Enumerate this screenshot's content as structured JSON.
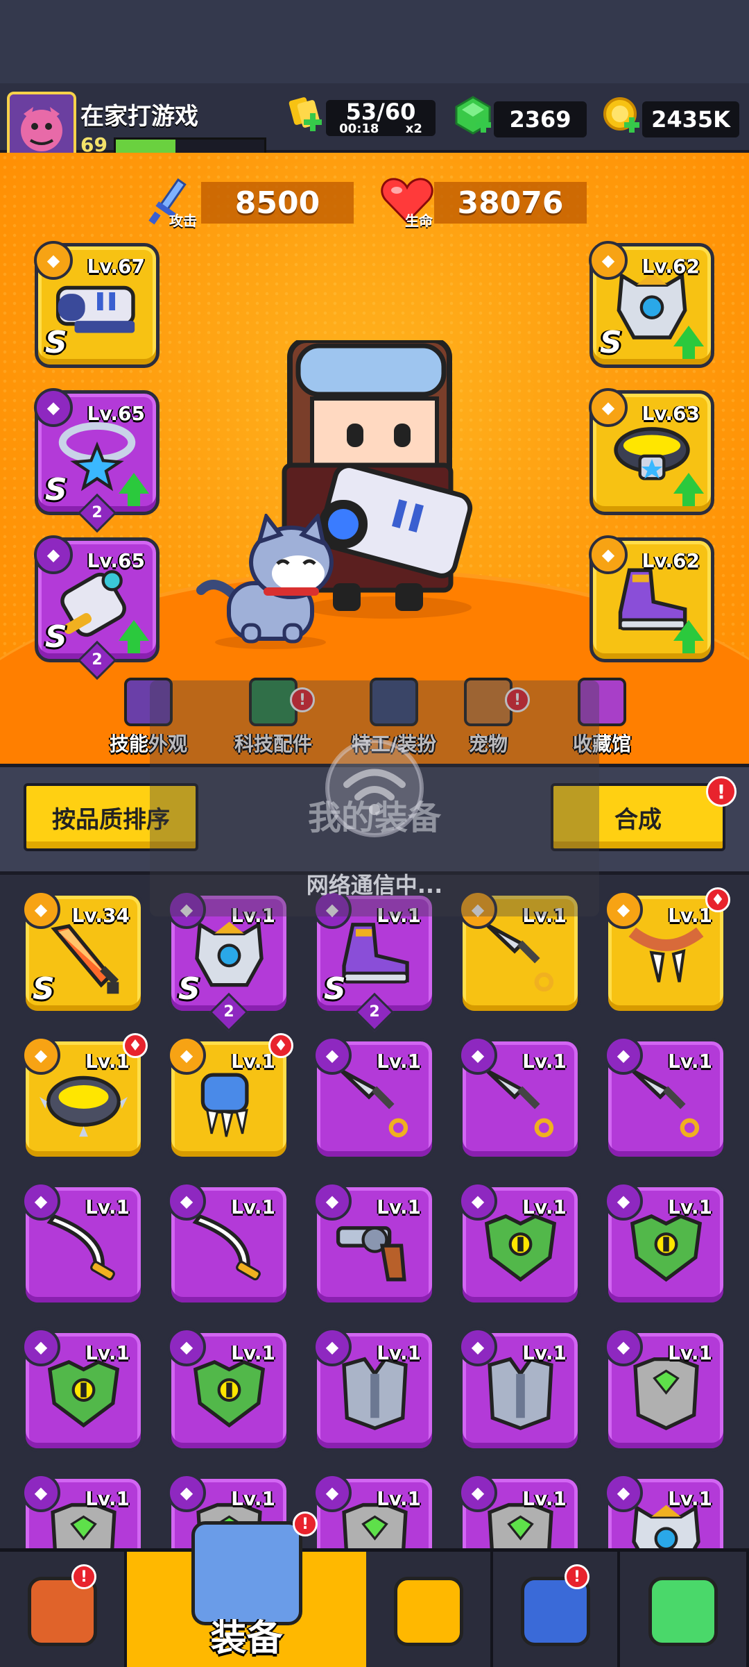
{
  "player": {
    "name": "在家打游戏",
    "level": "69",
    "xp_fraction": 0.4
  },
  "resources": {
    "energy": {
      "value": "53/60",
      "timer": "00:18",
      "multiplier": "x2",
      "icon": "energy-icon"
    },
    "gems": {
      "value": "2369",
      "icon": "gem-icon"
    },
    "coins": {
      "value": "2435K",
      "icon": "coin-icon"
    }
  },
  "stats": {
    "attack": {
      "value": "8500",
      "label": "攻击",
      "icon": "sword-icon"
    },
    "hp": {
      "value": "38076",
      "label": "生命",
      "icon": "heart-icon"
    }
  },
  "equipped": {
    "weapon": {
      "level": "Lv.67",
      "grade": "S",
      "slot_icon": "weapon-slot-icon",
      "item": "blaster-icon",
      "tier": "gold"
    },
    "armor": {
      "level": "Lv.62",
      "grade": "S",
      "slot_icon": "armor-slot-icon",
      "item": "robot-armor-icon",
      "tier": "gold",
      "upgrade": true
    },
    "necklace": {
      "level": "Lv.65",
      "grade": "S",
      "stars": "2",
      "slot_icon": "necklace-slot-icon",
      "item": "star-necklace-icon",
      "tier": "purple",
      "upgrade": true
    },
    "belt": {
      "level": "Lv.63",
      "slot_icon": "belt-slot-icon",
      "item": "belt-icon",
      "tier": "gold",
      "upgrade": true
    },
    "gloves": {
      "level": "Lv.65",
      "grade": "S",
      "stars": "2",
      "slot_icon": "glove-slot-icon",
      "item": "mech-glove-icon",
      "tier": "purple",
      "upgrade": true
    },
    "boots": {
      "level": "Lv.62",
      "slot_icon": "boots-slot-icon",
      "item": "sneaker-icon",
      "tier": "gold",
      "upgrade": true
    }
  },
  "nav": [
    {
      "label": "技能外观",
      "icon": "skill-skin-icon",
      "alert": false
    },
    {
      "label": "科技配件",
      "icon": "tech-part-icon",
      "alert": true
    },
    {
      "label": "特工/装扮",
      "icon": "agent-icon",
      "alert": false,
      "upgrade": true
    },
    {
      "label": "宠物",
      "icon": "pet-icon",
      "alert": true
    },
    {
      "label": "收藏馆",
      "icon": "collection-icon",
      "alert": false
    }
  ],
  "panel": {
    "sort_label": "按品质排序",
    "title": "我的装备",
    "merge_label": "合成",
    "merge_alert": "!",
    "loading": "网络通信中..."
  },
  "inventory": [
    {
      "level": "Lv.34",
      "tier": "gold",
      "grade": "S",
      "icon": "sword-icon",
      "slot": "weapon"
    },
    {
      "level": "Lv.1",
      "tier": "purple",
      "grade": "S",
      "stars": "2",
      "icon": "robot-armor-icon",
      "slot": "armor"
    },
    {
      "level": "Lv.1",
      "tier": "purple",
      "grade": "S",
      "stars": "2",
      "icon": "sneaker-icon",
      "slot": "boots"
    },
    {
      "level": "Lv.1",
      "tier": "gold",
      "icon": "kunai-icon",
      "slot": "weapon"
    },
    {
      "level": "Lv.1",
      "tier": "gold",
      "icon": "fang-necklace-icon",
      "slot": "necklace",
      "new": true
    },
    {
      "level": "Lv.1",
      "tier": "gold",
      "icon": "spiked-ring-icon",
      "slot": "belt",
      "new": true
    },
    {
      "level": "Lv.1",
      "tier": "gold",
      "icon": "claw-glove-icon",
      "slot": "gloves",
      "new": true
    },
    {
      "level": "Lv.1",
      "tier": "purple",
      "icon": "kunai-icon",
      "slot": "weapon"
    },
    {
      "level": "Lv.1",
      "tier": "purple",
      "icon": "kunai-icon",
      "slot": "weapon"
    },
    {
      "level": "Lv.1",
      "tier": "purple",
      "icon": "kunai-icon",
      "slot": "weapon"
    },
    {
      "level": "Lv.1",
      "tier": "purple",
      "icon": "scimitar-icon",
      "slot": "weapon"
    },
    {
      "level": "Lv.1",
      "tier": "purple",
      "icon": "scimitar-icon",
      "slot": "weapon"
    },
    {
      "level": "Lv.1",
      "tier": "purple",
      "icon": "revolver-icon",
      "slot": "weapon"
    },
    {
      "level": "Lv.1",
      "tier": "purple",
      "icon": "green-armor-icon",
      "slot": "armor"
    },
    {
      "level": "Lv.1",
      "tier": "purple",
      "icon": "green-armor-icon",
      "slot": "armor"
    },
    {
      "level": "Lv.1",
      "tier": "purple",
      "icon": "green-armor-icon",
      "slot": "armor"
    },
    {
      "level": "Lv.1",
      "tier": "purple",
      "icon": "green-armor-icon",
      "slot": "armor"
    },
    {
      "level": "Lv.1",
      "tier": "purple",
      "icon": "steel-armor-icon",
      "slot": "armor"
    },
    {
      "level": "Lv.1",
      "tier": "purple",
      "icon": "steel-armor-icon",
      "slot": "armor"
    },
    {
      "level": "Lv.1",
      "tier": "purple",
      "icon": "stone-armor-icon",
      "slot": "armor"
    },
    {
      "level": "Lv.1",
      "tier": "purple",
      "icon": "stone-armor-icon",
      "slot": "armor"
    },
    {
      "level": "Lv.1",
      "tier": "purple",
      "icon": "stone-armor-icon",
      "slot": "armor"
    },
    {
      "level": "Lv.1",
      "tier": "purple",
      "icon": "stone-armor-icon",
      "slot": "armor"
    },
    {
      "level": "Lv.1",
      "tier": "purple",
      "icon": "stone-armor-icon",
      "slot": "armor"
    },
    {
      "level": "Lv.1",
      "tier": "purple",
      "icon": "robot-armor-icon",
      "slot": "armor"
    }
  ],
  "bottom_nav": [
    {
      "label": "",
      "icon": "shop-icon",
      "alert": true
    },
    {
      "label": "装备",
      "icon": "equipment-icon",
      "alert": true,
      "active": true
    },
    {
      "label": "",
      "icon": "battle-star-icon",
      "alert": false
    },
    {
      "label": "",
      "icon": "talent-orb-icon",
      "alert": true
    },
    {
      "label": "",
      "icon": "dna-icon",
      "alert": false
    }
  ],
  "colors": {
    "gold": "#f7c213",
    "purple": "#b33ad8",
    "bg": "#2b2d3d",
    "stage": "#ff9a0c",
    "alert": "#e8232d",
    "upgrade": "#2bc93d"
  }
}
